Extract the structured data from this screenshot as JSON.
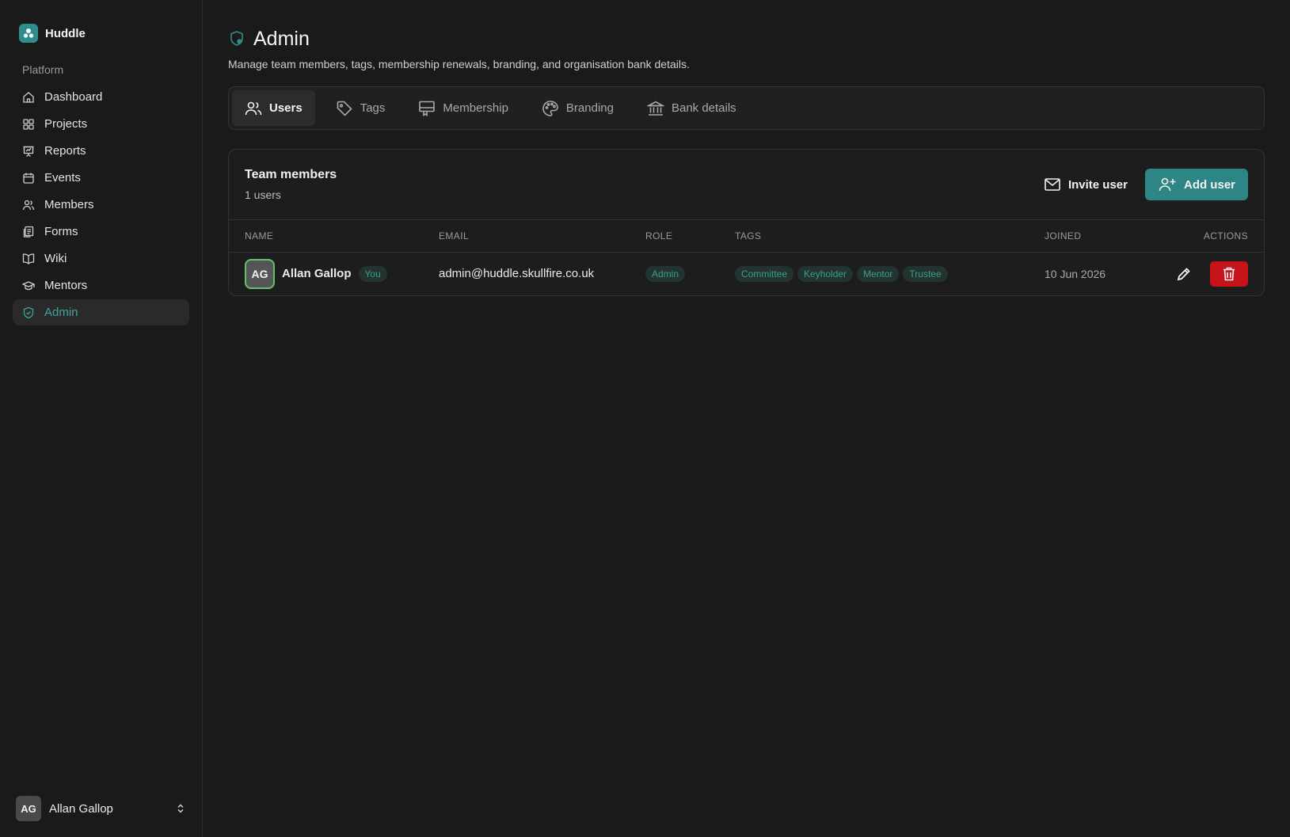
{
  "app": {
    "name": "Huddle"
  },
  "sidebar": {
    "section_label": "Platform",
    "items": [
      {
        "label": "Dashboard",
        "icon": "home-icon"
      },
      {
        "label": "Projects",
        "icon": "grid-icon"
      },
      {
        "label": "Reports",
        "icon": "presentation-icon"
      },
      {
        "label": "Events",
        "icon": "calendar-icon"
      },
      {
        "label": "Members",
        "icon": "users-icon"
      },
      {
        "label": "Forms",
        "icon": "forms-icon"
      },
      {
        "label": "Wiki",
        "icon": "book-icon"
      },
      {
        "label": "Mentors",
        "icon": "graduation-cap-icon"
      },
      {
        "label": "Admin",
        "icon": "shield-icon",
        "active": true
      }
    ],
    "user": {
      "initials": "AG",
      "name": "Allan Gallop"
    }
  },
  "page": {
    "title": "Admin",
    "subtitle": "Manage team members, tags, membership renewals, branding, and organisation bank details."
  },
  "tabs": [
    {
      "label": "Users",
      "icon": "users-icon",
      "active": true
    },
    {
      "label": "Tags",
      "icon": "tag-icon"
    },
    {
      "label": "Membership",
      "icon": "id-card-icon"
    },
    {
      "label": "Branding",
      "icon": "palette-icon"
    },
    {
      "label": "Bank details",
      "icon": "bank-icon"
    }
  ],
  "team": {
    "title": "Team members",
    "count_label": "1 users",
    "invite_label": "Invite user",
    "add_label": "Add user",
    "columns": [
      "NAME",
      "EMAIL",
      "ROLE",
      "TAGS",
      "JOINED",
      "ACTIONS"
    ],
    "rows": [
      {
        "initials": "AG",
        "name": "Allan Gallop",
        "you_badge": "You",
        "email": "admin@huddle.skullfire.co.uk",
        "role": "Admin",
        "tags": [
          "Committee",
          "Keyholder",
          "Mentor",
          "Trustee"
        ],
        "joined": "10 Jun 2026"
      }
    ]
  },
  "colors": {
    "accent": "#2e8586",
    "accent_text": "#3aa7a2",
    "danger": "#c8121a",
    "background": "#1a1a1a",
    "avatar_ring": "#62c46a"
  }
}
